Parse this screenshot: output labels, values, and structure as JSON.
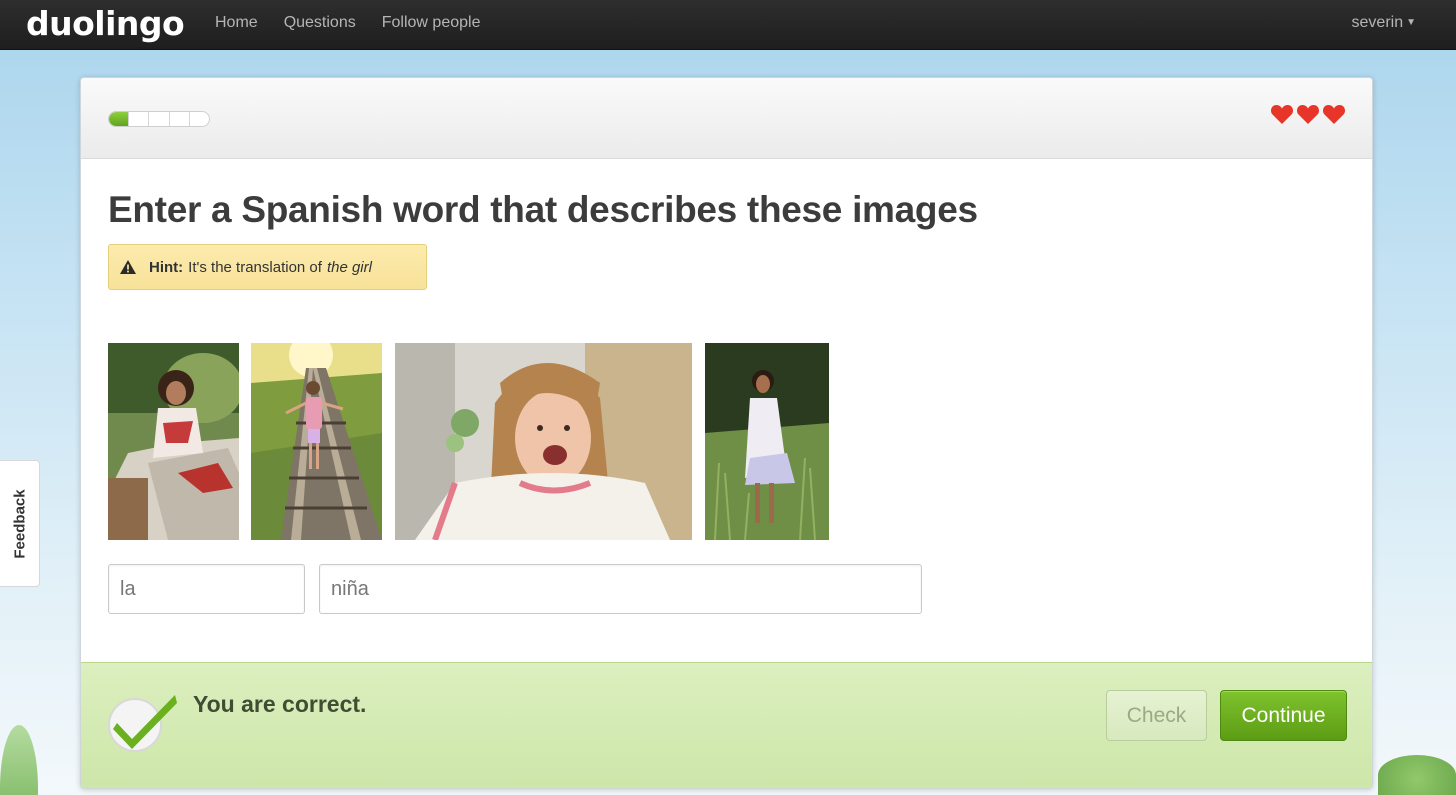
{
  "nav": {
    "logo": "duolingo",
    "links": [
      "Home",
      "Questions",
      "Follow people"
    ],
    "user": "severin"
  },
  "feedback_tab": "Feedback",
  "lesson": {
    "progress_fraction": 0.2,
    "progress_segments": 5,
    "hearts": 3,
    "heart_color": "#e8352a",
    "prompt_bold": "Enter a Spanish word",
    "prompt_rest": "that describes these images",
    "hint": {
      "label": "Hint:",
      "text": "It's the translation of",
      "term": "the girl"
    },
    "images": [
      {
        "alt": "girl-on-horse"
      },
      {
        "alt": "girl-on-railway-tracks"
      },
      {
        "alt": "girl-surprised"
      },
      {
        "alt": "girl-in-grass"
      }
    ],
    "answer": {
      "article": "la",
      "word": "niña"
    }
  },
  "footer": {
    "status": "You are correct.",
    "check_label": "Check",
    "continue_label": "Continue",
    "accent": "#6bb01f"
  }
}
